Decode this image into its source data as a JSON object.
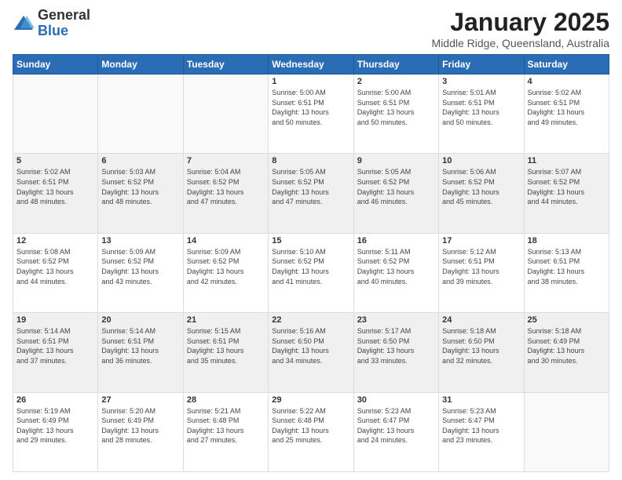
{
  "header": {
    "logo_general": "General",
    "logo_blue": "Blue",
    "month_title": "January 2025",
    "location": "Middle Ridge, Queensland, Australia"
  },
  "days_of_week": [
    "Sunday",
    "Monday",
    "Tuesday",
    "Wednesday",
    "Thursday",
    "Friday",
    "Saturday"
  ],
  "weeks": [
    [
      {
        "day": "",
        "info": ""
      },
      {
        "day": "",
        "info": ""
      },
      {
        "day": "",
        "info": ""
      },
      {
        "day": "1",
        "info": "Sunrise: 5:00 AM\nSunset: 6:51 PM\nDaylight: 13 hours\nand 50 minutes."
      },
      {
        "day": "2",
        "info": "Sunrise: 5:00 AM\nSunset: 6:51 PM\nDaylight: 13 hours\nand 50 minutes."
      },
      {
        "day": "3",
        "info": "Sunrise: 5:01 AM\nSunset: 6:51 PM\nDaylight: 13 hours\nand 50 minutes."
      },
      {
        "day": "4",
        "info": "Sunrise: 5:02 AM\nSunset: 6:51 PM\nDaylight: 13 hours\nand 49 minutes."
      }
    ],
    [
      {
        "day": "5",
        "info": "Sunrise: 5:02 AM\nSunset: 6:51 PM\nDaylight: 13 hours\nand 48 minutes."
      },
      {
        "day": "6",
        "info": "Sunrise: 5:03 AM\nSunset: 6:52 PM\nDaylight: 13 hours\nand 48 minutes."
      },
      {
        "day": "7",
        "info": "Sunrise: 5:04 AM\nSunset: 6:52 PM\nDaylight: 13 hours\nand 47 minutes."
      },
      {
        "day": "8",
        "info": "Sunrise: 5:05 AM\nSunset: 6:52 PM\nDaylight: 13 hours\nand 47 minutes."
      },
      {
        "day": "9",
        "info": "Sunrise: 5:05 AM\nSunset: 6:52 PM\nDaylight: 13 hours\nand 46 minutes."
      },
      {
        "day": "10",
        "info": "Sunrise: 5:06 AM\nSunset: 6:52 PM\nDaylight: 13 hours\nand 45 minutes."
      },
      {
        "day": "11",
        "info": "Sunrise: 5:07 AM\nSunset: 6:52 PM\nDaylight: 13 hours\nand 44 minutes."
      }
    ],
    [
      {
        "day": "12",
        "info": "Sunrise: 5:08 AM\nSunset: 6:52 PM\nDaylight: 13 hours\nand 44 minutes."
      },
      {
        "day": "13",
        "info": "Sunrise: 5:09 AM\nSunset: 6:52 PM\nDaylight: 13 hours\nand 43 minutes."
      },
      {
        "day": "14",
        "info": "Sunrise: 5:09 AM\nSunset: 6:52 PM\nDaylight: 13 hours\nand 42 minutes."
      },
      {
        "day": "15",
        "info": "Sunrise: 5:10 AM\nSunset: 6:52 PM\nDaylight: 13 hours\nand 41 minutes."
      },
      {
        "day": "16",
        "info": "Sunrise: 5:11 AM\nSunset: 6:52 PM\nDaylight: 13 hours\nand 40 minutes."
      },
      {
        "day": "17",
        "info": "Sunrise: 5:12 AM\nSunset: 6:51 PM\nDaylight: 13 hours\nand 39 minutes."
      },
      {
        "day": "18",
        "info": "Sunrise: 5:13 AM\nSunset: 6:51 PM\nDaylight: 13 hours\nand 38 minutes."
      }
    ],
    [
      {
        "day": "19",
        "info": "Sunrise: 5:14 AM\nSunset: 6:51 PM\nDaylight: 13 hours\nand 37 minutes."
      },
      {
        "day": "20",
        "info": "Sunrise: 5:14 AM\nSunset: 6:51 PM\nDaylight: 13 hours\nand 36 minutes."
      },
      {
        "day": "21",
        "info": "Sunrise: 5:15 AM\nSunset: 6:51 PM\nDaylight: 13 hours\nand 35 minutes."
      },
      {
        "day": "22",
        "info": "Sunrise: 5:16 AM\nSunset: 6:50 PM\nDaylight: 13 hours\nand 34 minutes."
      },
      {
        "day": "23",
        "info": "Sunrise: 5:17 AM\nSunset: 6:50 PM\nDaylight: 13 hours\nand 33 minutes."
      },
      {
        "day": "24",
        "info": "Sunrise: 5:18 AM\nSunset: 6:50 PM\nDaylight: 13 hours\nand 32 minutes."
      },
      {
        "day": "25",
        "info": "Sunrise: 5:18 AM\nSunset: 6:49 PM\nDaylight: 13 hours\nand 30 minutes."
      }
    ],
    [
      {
        "day": "26",
        "info": "Sunrise: 5:19 AM\nSunset: 6:49 PM\nDaylight: 13 hours\nand 29 minutes."
      },
      {
        "day": "27",
        "info": "Sunrise: 5:20 AM\nSunset: 6:49 PM\nDaylight: 13 hours\nand 28 minutes."
      },
      {
        "day": "28",
        "info": "Sunrise: 5:21 AM\nSunset: 6:48 PM\nDaylight: 13 hours\nand 27 minutes."
      },
      {
        "day": "29",
        "info": "Sunrise: 5:22 AM\nSunset: 6:48 PM\nDaylight: 13 hours\nand 25 minutes."
      },
      {
        "day": "30",
        "info": "Sunrise: 5:23 AM\nSunset: 6:47 PM\nDaylight: 13 hours\nand 24 minutes."
      },
      {
        "day": "31",
        "info": "Sunrise: 5:23 AM\nSunset: 6:47 PM\nDaylight: 13 hours\nand 23 minutes."
      },
      {
        "day": "",
        "info": ""
      }
    ]
  ]
}
